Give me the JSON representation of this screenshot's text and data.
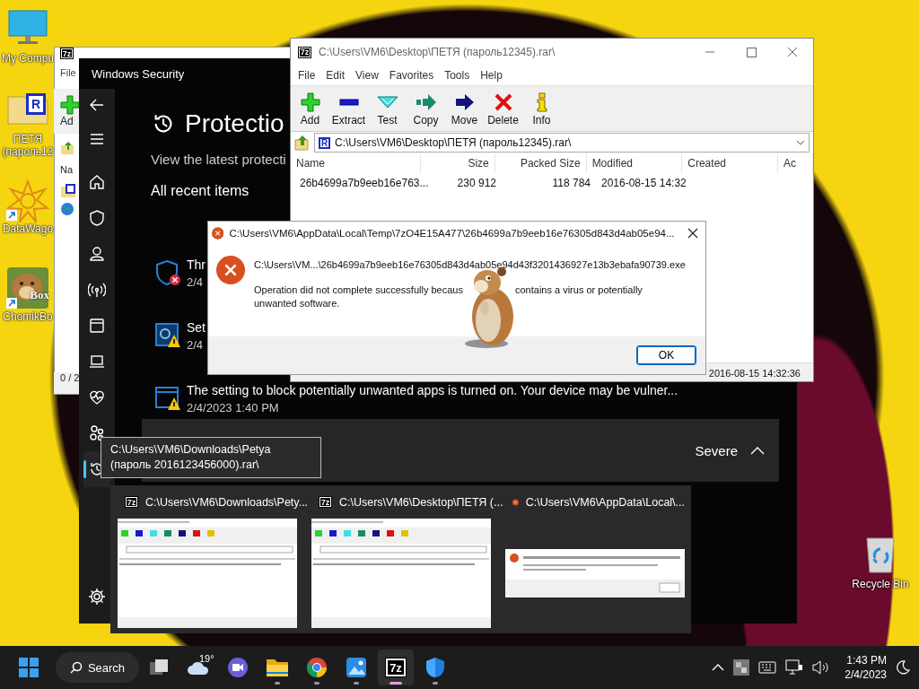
{
  "desktop_icons": [
    {
      "kind": "computer",
      "label": "My Compu",
      "shortcut": false
    },
    {
      "kind": "archive",
      "label": "ПЕТЯ (пароль12",
      "logo": "R",
      "shortcut": false
    },
    {
      "kind": "datawagon",
      "label": "DataWago",
      "shortcut": true
    },
    {
      "kind": "chomikbox",
      "label": "ChomikBo",
      "logo": "Box",
      "shortcut": true
    },
    {
      "kind": "recycle",
      "label": "Recycle Bin",
      "shortcut": false
    }
  ],
  "background_archive_window": {
    "logo": "7z",
    "menu": "File",
    "toolbar_label": "Ad",
    "column": "Na",
    "status": "0 / 2"
  },
  "security_window": {
    "title": "Windows Security",
    "nav": [
      {
        "kind": "back",
        "selected": false
      },
      {
        "kind": "menu",
        "selected": false
      },
      {
        "kind": "home",
        "selected": false
      },
      {
        "kind": "shield",
        "selected": false
      },
      {
        "kind": "account",
        "selected": false
      },
      {
        "kind": "network",
        "selected": false
      },
      {
        "kind": "app",
        "selected": false
      },
      {
        "kind": "device",
        "selected": false
      },
      {
        "kind": "health",
        "selected": false
      },
      {
        "kind": "family",
        "selected": false
      },
      {
        "kind": "history",
        "selected": true
      },
      {
        "kind": "settings",
        "selected": false
      }
    ],
    "heading": "Protectio",
    "subtitle": "View the latest protecti",
    "section": "All recent items",
    "items": [
      {
        "kind": "threat",
        "title": "Thr",
        "date": "2/4"
      },
      {
        "kind": "settings-warning",
        "title": "Set",
        "date": "2/4"
      },
      {
        "kind": "app-warning",
        "title": "The setting to block potentially unwanted apps is turned on. Your device may be vulner...",
        "date": "2/4/2023 1:40 PM"
      }
    ],
    "severity": {
      "label": "Severe",
      "expanded": true
    }
  },
  "archive_window": {
    "logo": "7z",
    "title": "C:\\Users\\VM6\\Desktop\\ПЕТЯ (пароль12345).rar\\",
    "menu": [
      "File",
      "Edit",
      "View",
      "Favorites",
      "Tools",
      "Help"
    ],
    "toolbar": [
      {
        "kind": "add",
        "label": "Add"
      },
      {
        "kind": "extract",
        "label": "Extract"
      },
      {
        "kind": "test",
        "label": "Test"
      },
      {
        "kind": "copy",
        "label": "Copy"
      },
      {
        "kind": "move",
        "label": "Move"
      },
      {
        "kind": "delete",
        "label": "Delete"
      },
      {
        "kind": "info",
        "label": "Info"
      }
    ],
    "address": {
      "logo": "R",
      "path": "C:\\Users\\VM6\\Desktop\\ПЕТЯ (пароль12345).rar\\"
    },
    "columns": [
      "Name",
      "Size",
      "Packed Size",
      "Modified",
      "Created",
      "Ac"
    ],
    "rows": [
      {
        "name": "26b4699a7b9eeb16e763...",
        "size": "230 912",
        "packed_size": "118 784",
        "modified": "2016-08-15 14:32",
        "selected": false
      }
    ],
    "status": "2016-08-15 14:32:36"
  },
  "error_dialog": {
    "title": "C:\\Users\\VM6\\AppData\\Local\\Temp\\7zO4E15A477\\26b4699a7b9eeb16e76305d843d4ab05e94...",
    "file": "C:\\Users\\VM...\\26b4699a7b9eeb16e76305d843d4ab05e94d43f3201436927e13b3ebafa90739.exe",
    "message": [
      "Operation did not complete successfully becaus",
      "contains a virus or potentially",
      "unwanted software."
    ],
    "button": "OK"
  },
  "tooltip": {
    "text": "C:\\Users\\VM6\\Downloads\\Petya (пароль 2016123456000).rar\\"
  },
  "thumbnails": [
    {
      "kind": "archive",
      "logo": "7z",
      "title": "C:\\Users\\VM6\\Downloads\\Pety..."
    },
    {
      "kind": "archive",
      "logo": "7z",
      "title": "C:\\Users\\VM6\\Desktop\\ПЕТЯ (..."
    },
    {
      "kind": "error",
      "title": "C:\\Users\\VM6\\AppData\\Local\\..."
    }
  ],
  "taskbar": {
    "search": "Search",
    "apps": [
      {
        "kind": "taskview",
        "running": false,
        "selected": false
      },
      {
        "kind": "weather",
        "label": "19°",
        "running": false,
        "selected": false
      },
      {
        "kind": "chat",
        "running": false,
        "selected": false
      },
      {
        "kind": "explorer",
        "running": true,
        "selected": false
      },
      {
        "kind": "chrome",
        "running": true,
        "selected": false
      },
      {
        "kind": "photos",
        "running": true,
        "selected": false
      },
      {
        "kind": "archiver",
        "logo": "7z",
        "running": true,
        "selected": true
      },
      {
        "kind": "security",
        "running": true,
        "selected": false
      }
    ],
    "tray": [
      {
        "kind": "chevron"
      },
      {
        "kind": "app"
      },
      {
        "kind": "keyboard"
      },
      {
        "kind": "network"
      },
      {
        "kind": "volume"
      }
    ],
    "time": "1:43 PM",
    "date": "2/4/2023"
  }
}
